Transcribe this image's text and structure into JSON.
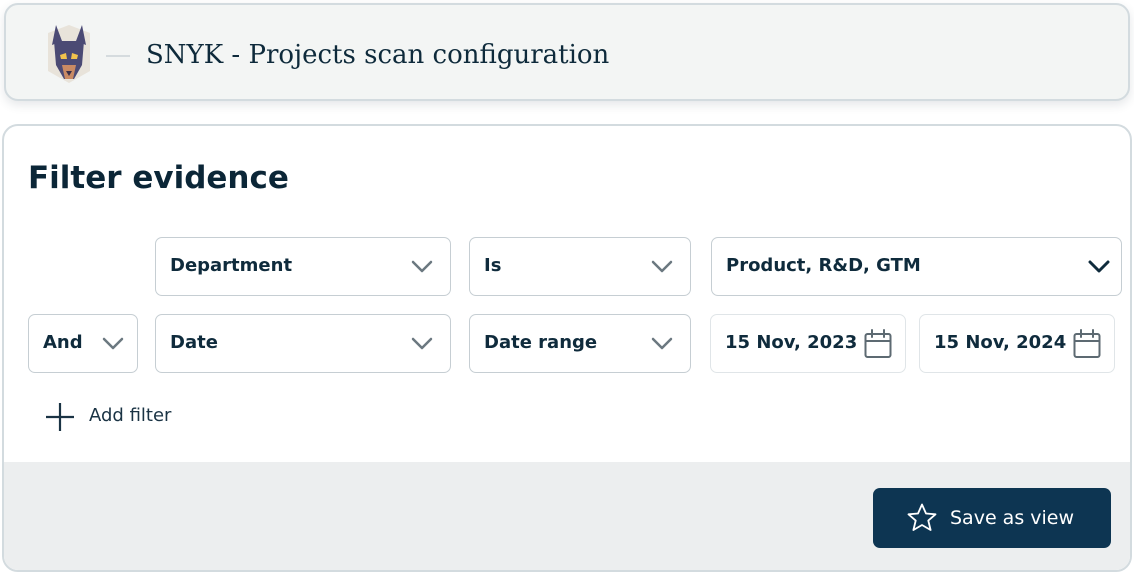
{
  "header": {
    "title": "SNYK - Projects scan configuration",
    "logo_icon": "doberman-logo-icon"
  },
  "panel": {
    "title": "Filter evidence"
  },
  "filter_rows": [
    {
      "connector": null,
      "field": "Department",
      "operator": "Is",
      "value": "Product, R&D, GTM"
    },
    {
      "connector": "And",
      "field": "Date",
      "operator": "Date range",
      "start_date": "15 Nov, 2023",
      "end_date": "15 Nov, 2024"
    }
  ],
  "add_filter": {
    "label": "Add filter",
    "icon": "plus-icon"
  },
  "save_button": {
    "label": "Save as view",
    "icon": "star-icon"
  },
  "colors": {
    "brand_dark": "#0d3552",
    "text": "#0d2a3d",
    "border": "#c6ced3",
    "footer_bg": "#eceeef",
    "header_bg": "#f3f5f4"
  }
}
